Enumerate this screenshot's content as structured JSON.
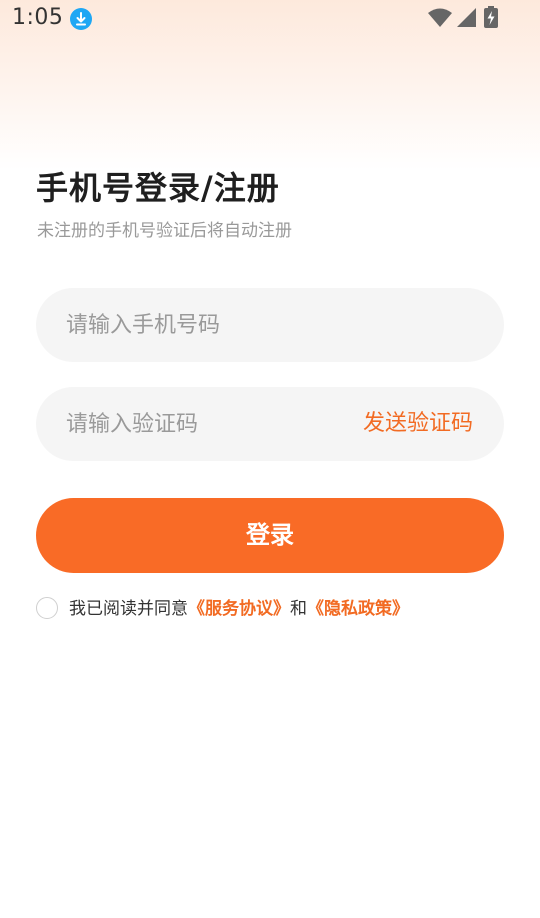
{
  "status_bar": {
    "time": "1:05",
    "icons": [
      "download-icon",
      "wifi-icon",
      "signal-icon",
      "battery-charging-icon"
    ]
  },
  "header": {
    "title": "手机号登录/注册",
    "subtitle": "未注册的手机号验证后将自动注册"
  },
  "form": {
    "phone_placeholder": "请输入手机号码",
    "phone_value": "",
    "code_placeholder": "请输入验证码",
    "code_value": "",
    "send_code_label": "发送验证码",
    "login_label": "登录"
  },
  "agreement": {
    "checked": false,
    "prefix": "我已阅读并同意",
    "service_link": "《服务协议》",
    "connector": "和",
    "privacy_link": "《隐私政策》"
  },
  "colors": {
    "accent": "#f96b26",
    "link": "#f26b23",
    "field_bg": "#f5f5f5",
    "download_badge": "#1ea7f4"
  }
}
